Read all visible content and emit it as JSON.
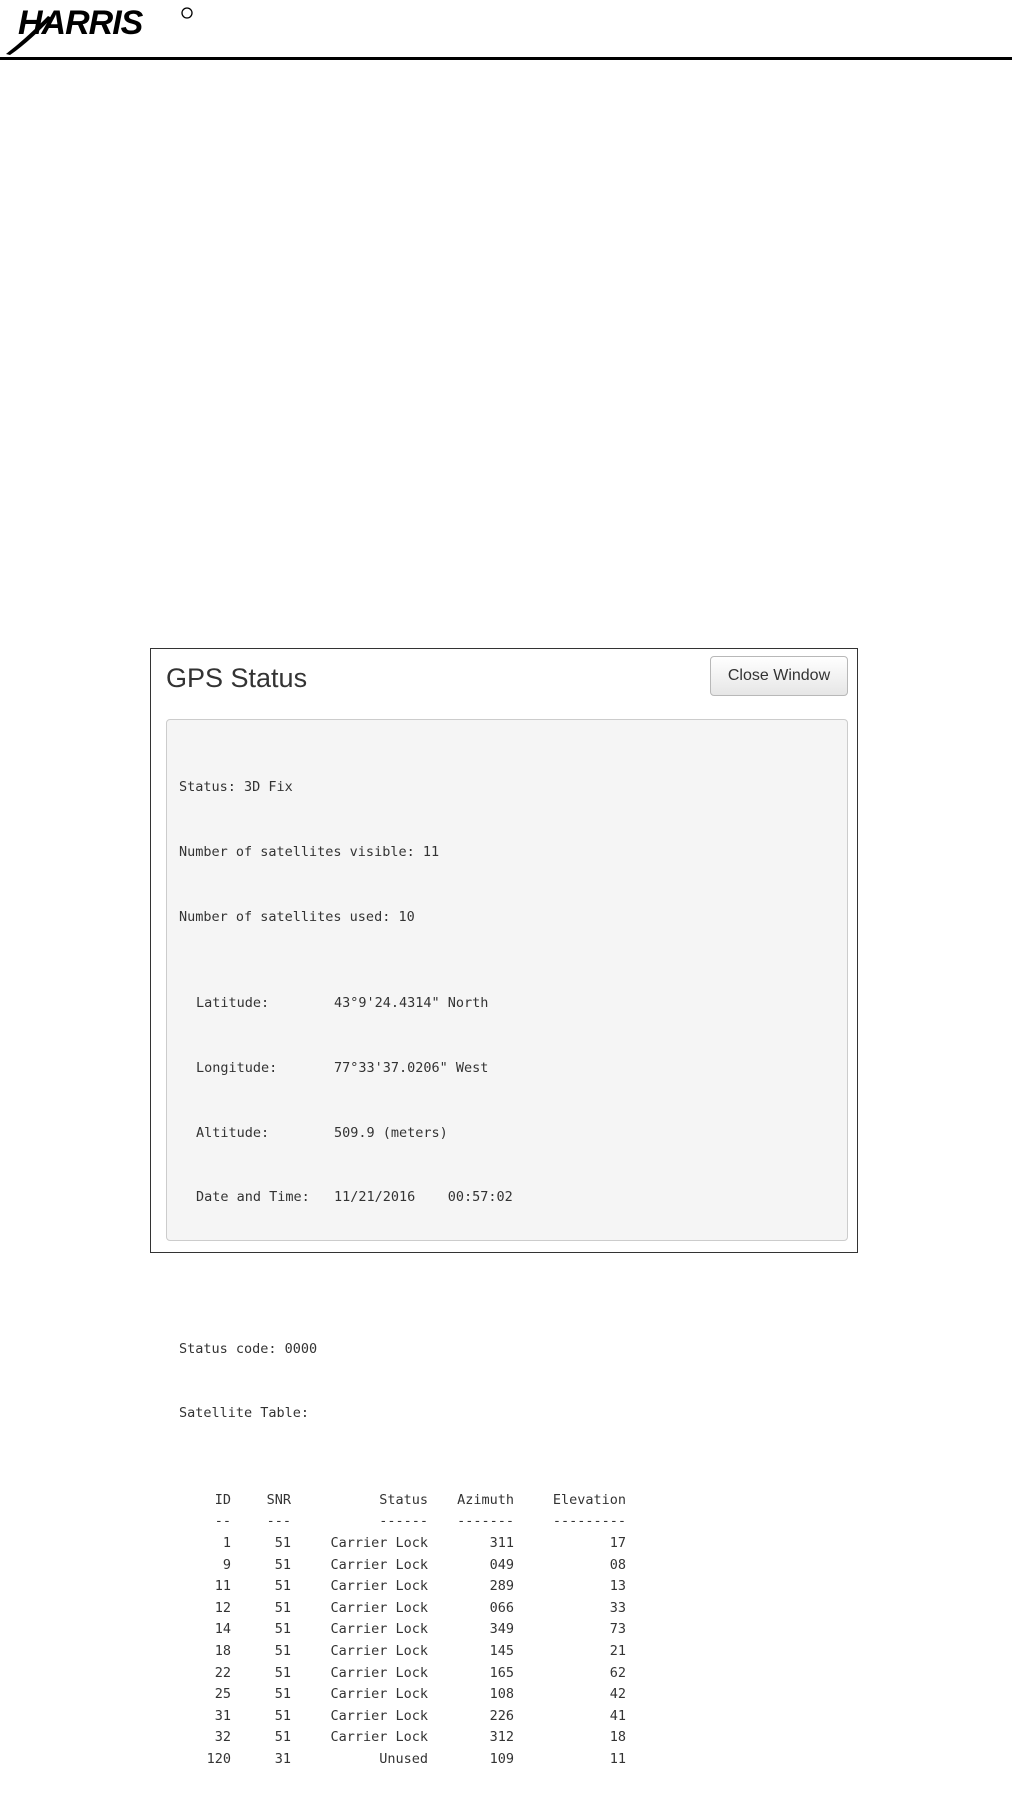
{
  "header": {
    "logo_text": "HARRIS",
    "logo_mark": "®"
  },
  "window": {
    "title": "GPS Status",
    "close_button": "Close Window"
  },
  "status": {
    "status_line": "Status: 3D Fix",
    "visible_line": "Number of satellites visible: 11",
    "used_line": "Number of satellites used: 10",
    "fields": [
      {
        "label": "Latitude:",
        "value": "43°9'24.4314\" North"
      },
      {
        "label": "Longitude:",
        "value": "77°33'37.0206\" West"
      },
      {
        "label": "Altitude:",
        "value": "509.9 (meters)"
      },
      {
        "label": "Date and Time:",
        "value": "11/21/2016    00:57:02"
      }
    ],
    "status_code_line": "Status code: 0000",
    "table_title": "Satellite Table:"
  },
  "satellite_table": {
    "headers": [
      "ID",
      "SNR",
      "Status",
      "Azimuth",
      "Elevation"
    ],
    "separators": [
      "--",
      "---",
      "------",
      "-------",
      "---------"
    ],
    "rows": [
      [
        "1",
        "51",
        "Carrier Lock",
        "311",
        "17"
      ],
      [
        "9",
        "51",
        "Carrier Lock",
        "049",
        "08"
      ],
      [
        "11",
        "51",
        "Carrier Lock",
        "289",
        "13"
      ],
      [
        "12",
        "51",
        "Carrier Lock",
        "066",
        "33"
      ],
      [
        "14",
        "51",
        "Carrier Lock",
        "349",
        "73"
      ],
      [
        "18",
        "51",
        "Carrier Lock",
        "145",
        "21"
      ],
      [
        "22",
        "51",
        "Carrier Lock",
        "165",
        "62"
      ],
      [
        "25",
        "51",
        "Carrier Lock",
        "108",
        "42"
      ],
      [
        "31",
        "51",
        "Carrier Lock",
        "226",
        "41"
      ],
      [
        "32",
        "51",
        "Carrier Lock",
        "312",
        "18"
      ],
      [
        "120",
        "31",
        "Unused",
        "109",
        "11"
      ]
    ]
  }
}
